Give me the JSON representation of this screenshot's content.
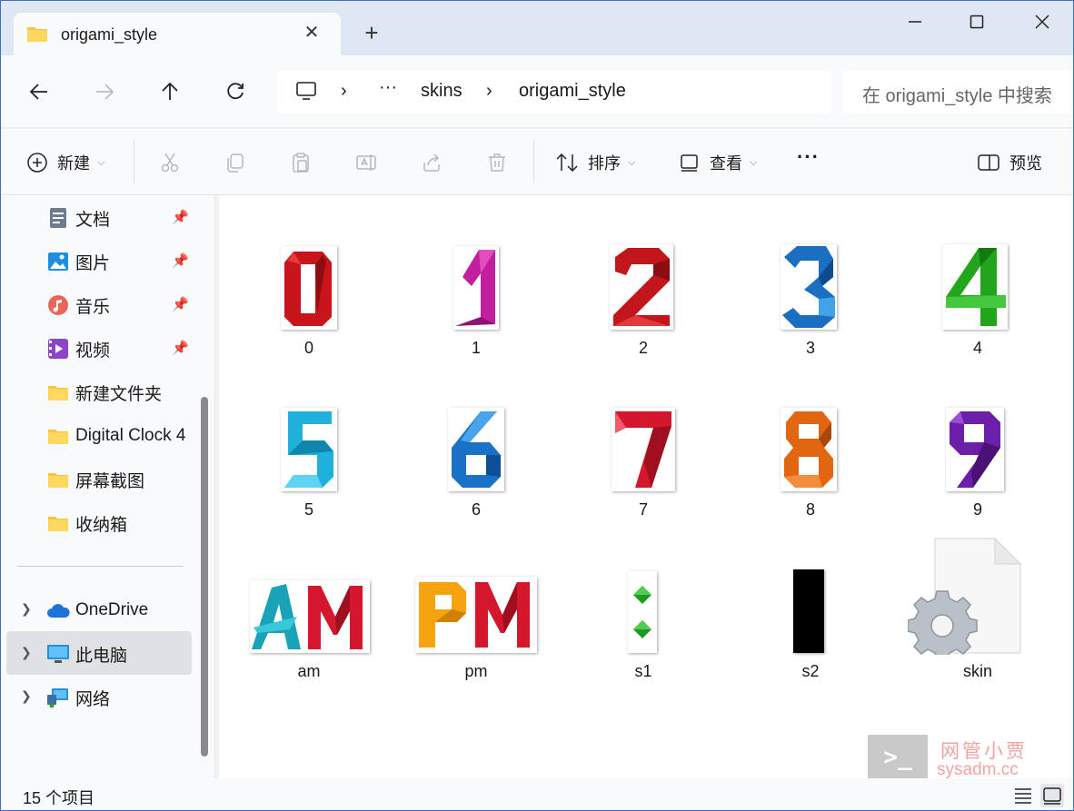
{
  "tab": {
    "title": "origami_style",
    "close": "✕",
    "new_tab": "+"
  },
  "address": {
    "crumbs": [
      "›",
      "···",
      "skins",
      "›",
      "origami_style"
    ],
    "sep1": "›",
    "more": "···",
    "skins": "skins",
    "sep2": "›",
    "current": "origami_style",
    "search_placeholder": "在 origami_style 中搜索"
  },
  "toolbar": {
    "new_label": "新建",
    "sort_label": "排序",
    "view_label": "查看",
    "more_label": "···",
    "preview_label": "预览"
  },
  "sidebar": {
    "items": [
      {
        "label": "文档",
        "icon": "document-icon",
        "pinned": true
      },
      {
        "label": "图片",
        "icon": "pictures-icon",
        "pinned": true
      },
      {
        "label": "音乐",
        "icon": "music-icon",
        "pinned": true
      },
      {
        "label": "视频",
        "icon": "video-icon",
        "pinned": true
      },
      {
        "label": "新建文件夹",
        "icon": "folder-icon",
        "pinned": false
      },
      {
        "label": "Digital Clock 4",
        "icon": "folder-icon",
        "pinned": false
      },
      {
        "label": "屏幕截图",
        "icon": "folder-icon",
        "pinned": false
      },
      {
        "label": "收纳箱",
        "icon": "folder-icon",
        "pinned": false
      }
    ],
    "roots": [
      {
        "label": "OneDrive",
        "icon": "onedrive-icon"
      },
      {
        "label": "此电脑",
        "icon": "this-pc-icon",
        "selected": true
      },
      {
        "label": "网络",
        "icon": "network-icon"
      }
    ]
  },
  "files": [
    {
      "name": "0",
      "glyph": "0",
      "color": "#c8151b"
    },
    {
      "name": "1",
      "glyph": "1",
      "color": "#c21e9e"
    },
    {
      "name": "2",
      "glyph": "2",
      "color": "#c0161c"
    },
    {
      "name": "3",
      "glyph": "3",
      "color": "#1a6fc2"
    },
    {
      "name": "4",
      "glyph": "4",
      "color": "#22a51c"
    },
    {
      "name": "5",
      "glyph": "5",
      "color": "#1fb0dc"
    },
    {
      "name": "6",
      "glyph": "6",
      "color": "#1a72c8"
    },
    {
      "name": "7",
      "glyph": "7",
      "color": "#d4172c"
    },
    {
      "name": "8",
      "glyph": "8",
      "color": "#e2660f"
    },
    {
      "name": "9",
      "glyph": "9",
      "color": "#6b1fa8"
    },
    {
      "name": "am",
      "glyph_a": "A",
      "glyph_b": "M",
      "color_a": "#1aa2b8",
      "color_b": "#d4172c"
    },
    {
      "name": "pm",
      "glyph_a": "P",
      "glyph_b": "M",
      "color_a": "#f5a40f",
      "color_b": "#d4172c"
    },
    {
      "name": "s1",
      "color": "#1e9a1e"
    },
    {
      "name": "s2",
      "color": "#000000"
    },
    {
      "name": "skin",
      "icon": "config-file-icon"
    }
  ],
  "status": {
    "count": "15 个项目"
  },
  "watermark": {
    "prompt": ">_",
    "title": "网管小贾",
    "site": "sysadm.cc"
  }
}
